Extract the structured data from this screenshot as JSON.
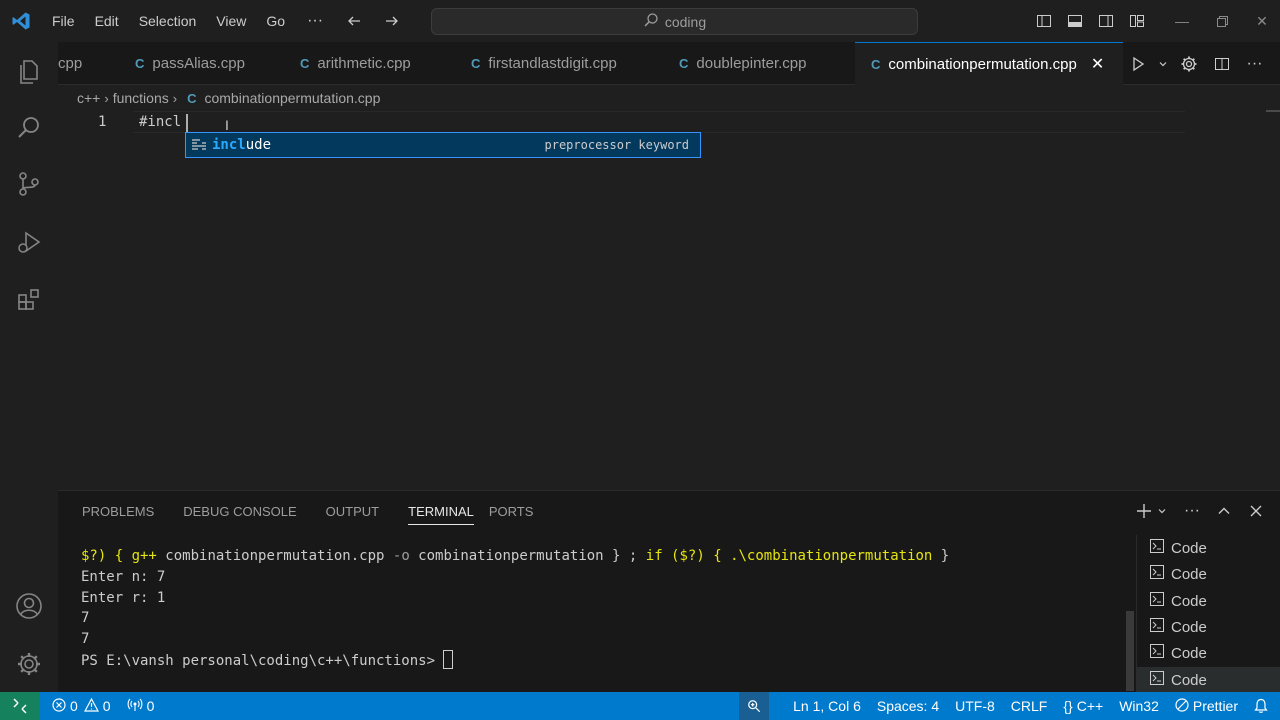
{
  "menu": [
    "File",
    "Edit",
    "Selection",
    "View",
    "Go"
  ],
  "menu_more": "···",
  "search": {
    "text": "coding"
  },
  "tabs": [
    {
      "label": "cpp"
    },
    {
      "label": "passAlias.cpp"
    },
    {
      "label": "arithmetic.cpp"
    },
    {
      "label": "firstandlastdigit.cpp"
    },
    {
      "label": "doublepinter.cpp"
    },
    {
      "label": "combinationpermutation.cpp",
      "active": true
    }
  ],
  "breadcrumb": {
    "root": "c++",
    "folder": "functions",
    "file": "combinationpermutation.cpp"
  },
  "editor": {
    "line_number": "1",
    "code": "#incl"
  },
  "suggestion": {
    "match": "incl",
    "rest": "ude",
    "detail": "preprocessor keyword"
  },
  "panel_tabs": [
    "PROBLEMS",
    "DEBUG CONSOLE",
    "OUTPUT",
    "TERMINAL",
    "PORTS"
  ],
  "terminal": {
    "cmd_a": "$?) { ",
    "cmd_b": "g++",
    "cmd_c": " combinationpermutation.cpp ",
    "cmd_d": "-o",
    "cmd_e": " combinationpermutation } ; ",
    "cmd_f": "if",
    "cmd_g": " ($?) { ",
    "cmd_h": ".\\combinationpermutation",
    "cmd_i": " }",
    "line2": "Enter n: 7",
    "line3": "Enter r: 1",
    "line4": "7",
    "line5": "7",
    "prompt": "PS E:\\vansh personal\\coding\\c++\\functions> "
  },
  "terminal_list": [
    "Code",
    "Code",
    "Code",
    "Code",
    "Code",
    "Code"
  ],
  "status": {
    "errors": "0",
    "warnings": "0",
    "ports": "0",
    "position": "Ln 1, Col 6",
    "spaces": "Spaces: 4",
    "encoding": "UTF-8",
    "eol": "CRLF",
    "language": "C++",
    "platform": "Win32",
    "formatter": "Prettier"
  },
  "colors": {
    "accent": "#007acc",
    "remote": "#16825d",
    "suggest_bg": "#04395e",
    "match": "#2aaaff"
  }
}
